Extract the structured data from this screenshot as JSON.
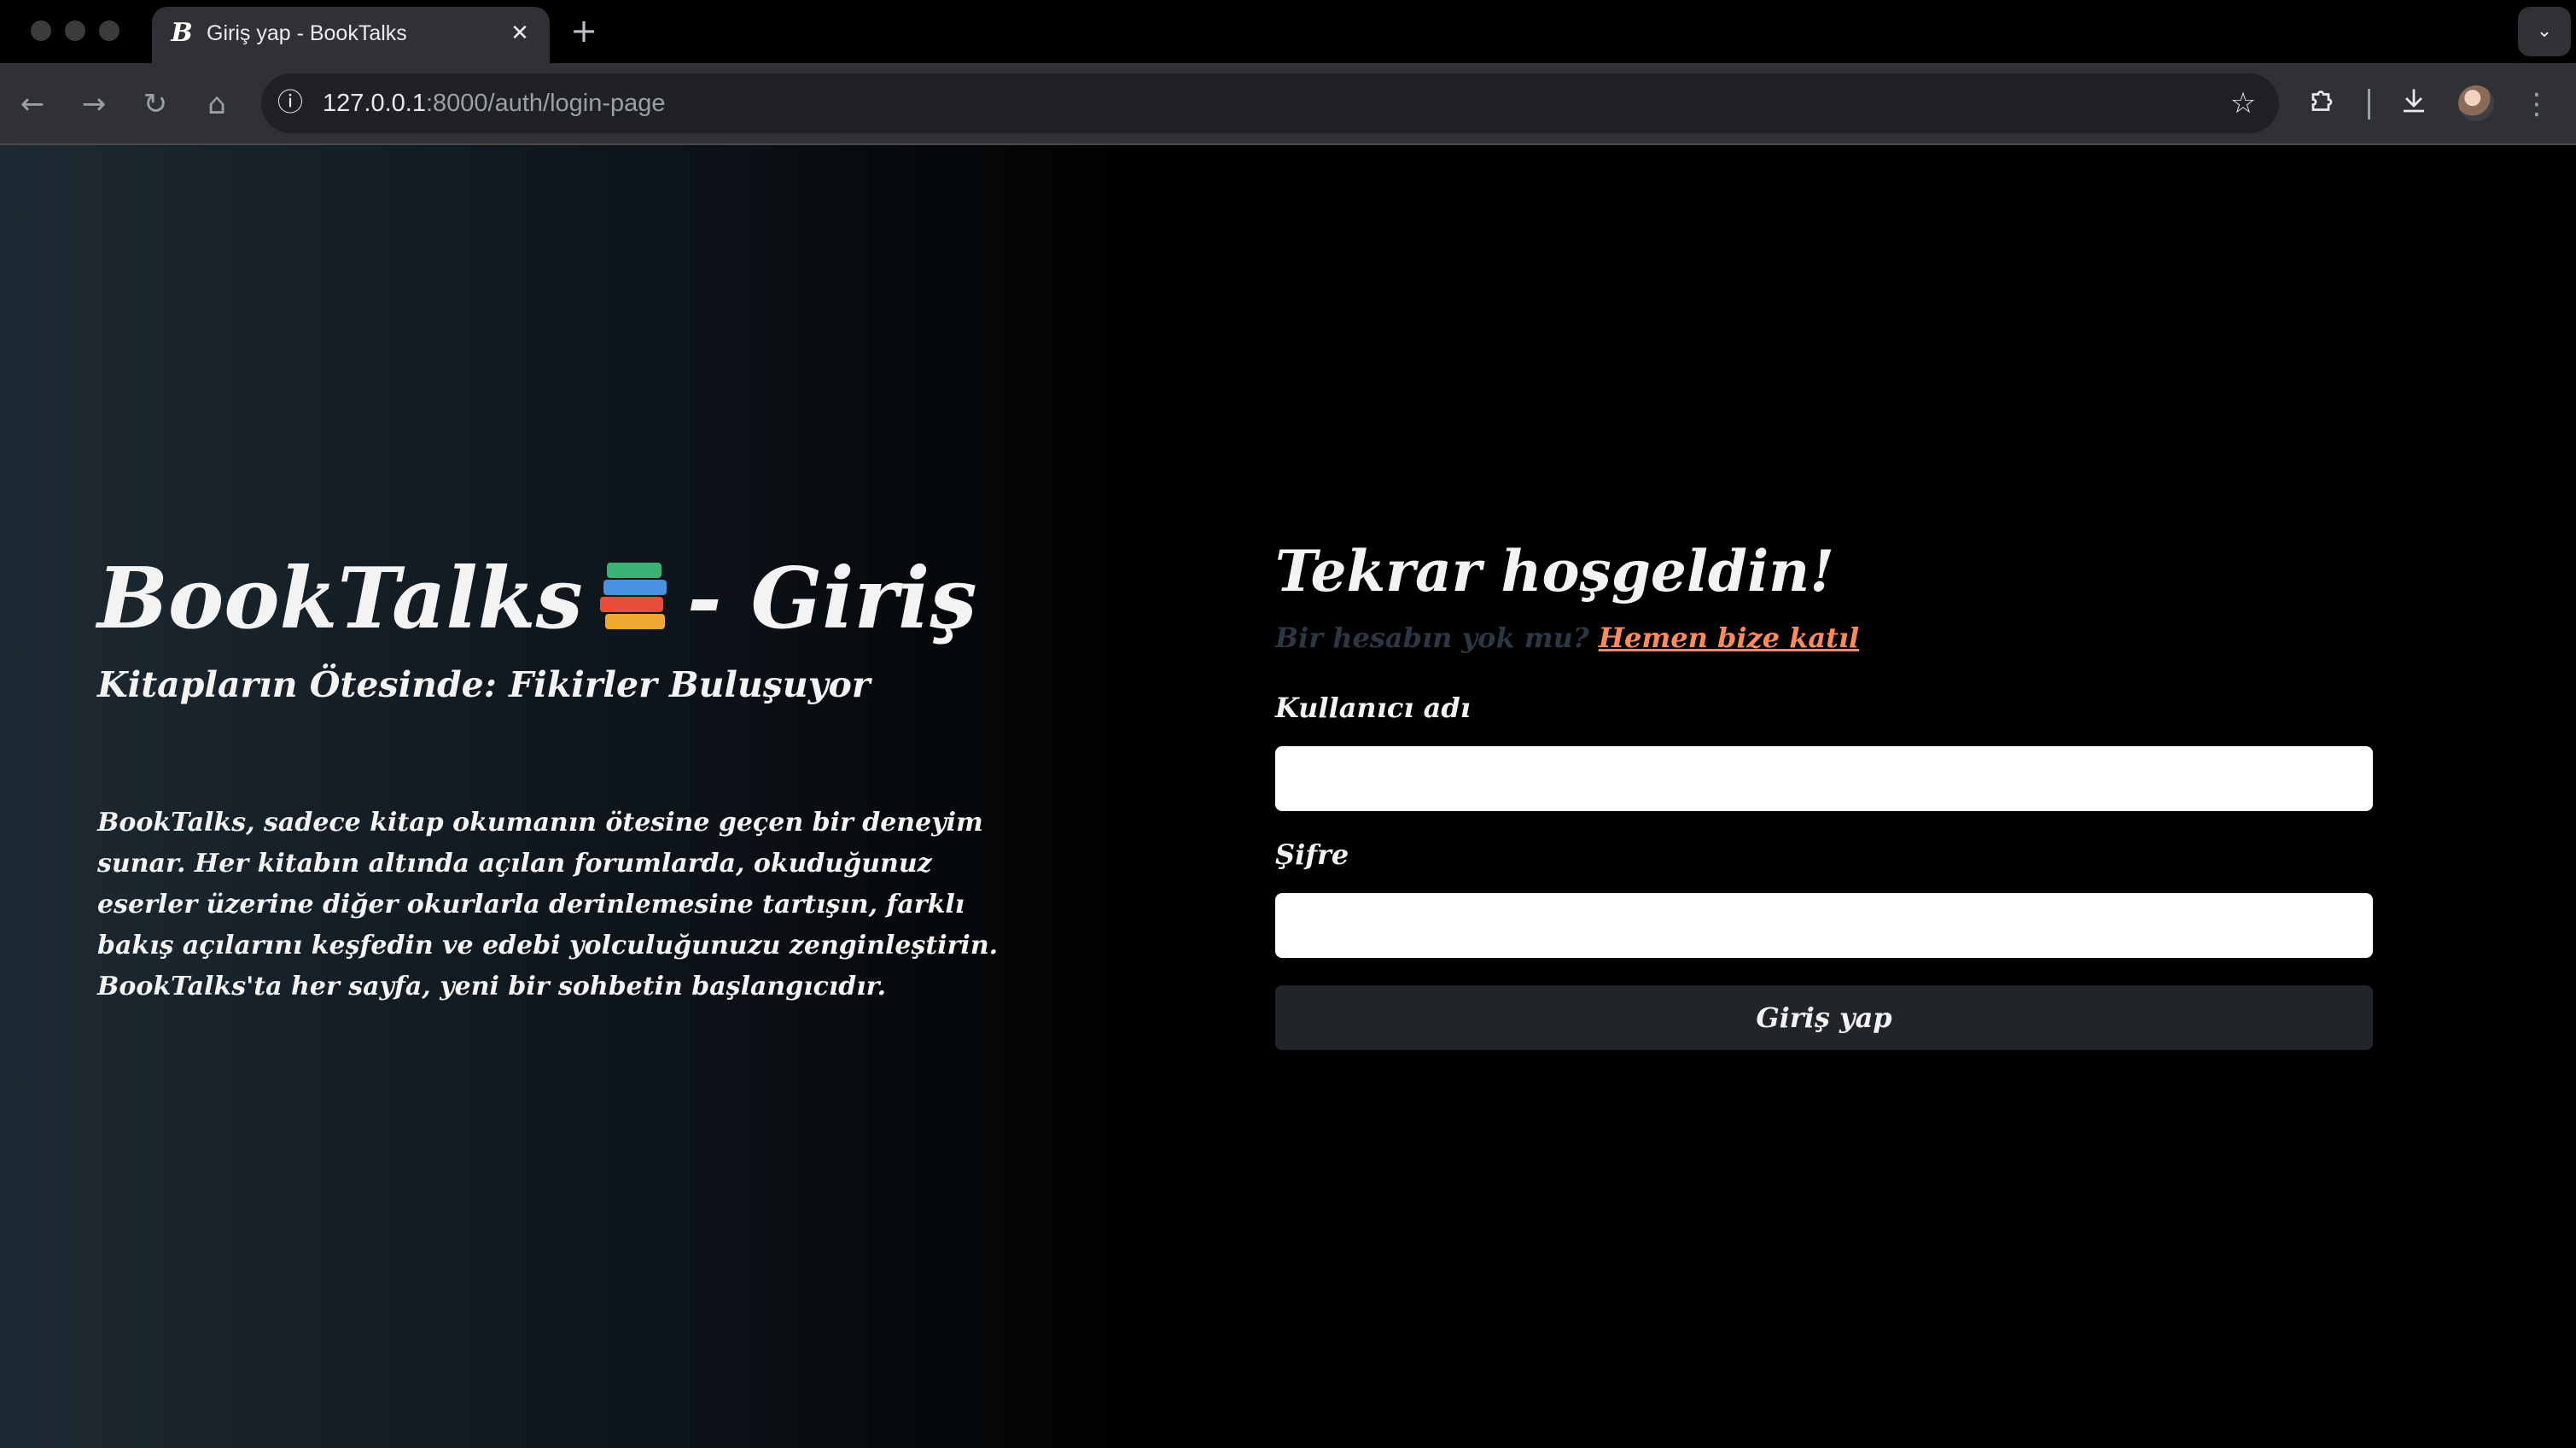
{
  "browser": {
    "tab": {
      "title": "Giriş yap - BookTalks",
      "favicon": "B"
    },
    "address": {
      "host": "127.0.0.1",
      "rest": ":8000/auth/login-page"
    }
  },
  "icons": {
    "back": "arrow-left-icon",
    "forward": "arrow-right-icon",
    "reload": "reload-icon",
    "home": "home-icon",
    "info": "info-icon",
    "star": "star-icon",
    "extensions": "puzzle-icon",
    "download": "download-icon",
    "menu": "kebab-menu-icon",
    "close": "close-icon",
    "new_tab": "plus-icon",
    "tab_search": "chevron-down-icon",
    "books": "books-emoji-icon"
  },
  "left": {
    "title_part1": "BookTalks",
    "title_part2": "- Giriş",
    "tagline": "Kitapların Ötesinde: Fikirler Buluşuyor",
    "description": "BookTalks, sadece kitap okumanın ötesine geçen bir deneyim sunar. Her kitabın altında açılan forumlarda, okuduğunuz eserler üzerine diğer okurlarla derinlemesine tartışın, farklı bakış açılarını keşfedin ve edebi yolculuğunuzu zenginleştirin. BookTalks'ta her sayfa, yeni bir sohbetin başlangıcıdır."
  },
  "form": {
    "heading": "Tekrar hoşgeldin!",
    "signup_question": "Bir hesabın yok mu?",
    "signup_link": "Hemen bize katıl",
    "username_label": "Kullanıcı adı",
    "username_value": "",
    "password_label": "Şifre",
    "password_value": "",
    "submit_label": "Giriş yap"
  },
  "colors": {
    "accent_link": "#ff8a5c",
    "muted_text": "#2b3742",
    "button_bg": "#212529",
    "page_gradient_start": "#1e2a33"
  }
}
